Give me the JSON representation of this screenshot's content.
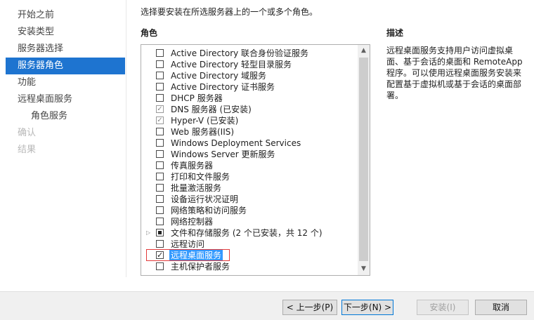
{
  "nav": {
    "items": [
      {
        "label": "开始之前",
        "state": "normal"
      },
      {
        "label": "安装类型",
        "state": "normal"
      },
      {
        "label": "服务器选择",
        "state": "normal"
      },
      {
        "label": "服务器角色",
        "state": "active"
      },
      {
        "label": "功能",
        "state": "normal"
      },
      {
        "label": "远程桌面服务",
        "state": "normal"
      },
      {
        "label": "角色服务",
        "state": "sub"
      },
      {
        "label": "确认",
        "state": "disabled"
      },
      {
        "label": "结果",
        "state": "disabled"
      }
    ]
  },
  "instruction": "选择要安装在所选服务器上的一个或多个角色。",
  "roles_header": "角色",
  "desc_header": "描述",
  "roles": [
    {
      "label": "Active Directory 联合身份验证服务",
      "check": "unchecked"
    },
    {
      "label": "Active Directory 轻型目录服务",
      "check": "unchecked"
    },
    {
      "label": "Active Directory 域服务",
      "check": "unchecked"
    },
    {
      "label": "Active Directory 证书服务",
      "check": "unchecked"
    },
    {
      "label": "DHCP 服务器",
      "check": "unchecked"
    },
    {
      "label": "DNS 服务器 (已安装)",
      "check": "disabled-checked"
    },
    {
      "label": "Hyper-V (已安装)",
      "check": "disabled-checked"
    },
    {
      "label": "Web 服务器(IIS)",
      "check": "unchecked"
    },
    {
      "label": "Windows Deployment Services",
      "check": "unchecked"
    },
    {
      "label": "Windows Server 更新服务",
      "check": "unchecked"
    },
    {
      "label": "传真服务器",
      "check": "unchecked"
    },
    {
      "label": "打印和文件服务",
      "check": "unchecked"
    },
    {
      "label": "批量激活服务",
      "check": "unchecked"
    },
    {
      "label": "设备运行状况证明",
      "check": "unchecked"
    },
    {
      "label": "网络策略和访问服务",
      "check": "unchecked"
    },
    {
      "label": "网络控制器",
      "check": "unchecked"
    },
    {
      "label": "文件和存储服务 (2 个已安装，共 12 个)",
      "check": "partial",
      "expandable": true
    },
    {
      "label": "远程访问",
      "check": "unchecked"
    },
    {
      "label": "远程桌面服务",
      "check": "checked",
      "selected": true,
      "highlighted": true
    },
    {
      "label": "主机保护者服务",
      "check": "unchecked"
    }
  ],
  "description": "远程桌面服务支持用户访问虚拟桌面、基于会话的桌面和 RemoteApp 程序。可以使用远程桌面服务安装来配置基于虚拟机或基于会话的桌面部署。",
  "buttons": {
    "prev": "< 上一步(P)",
    "next": "下一步(N) >",
    "install": "安装(I)",
    "cancel": "取消"
  },
  "icons": {
    "expander": "expand-triangle-icon",
    "scroll_up": "chevron-up-icon",
    "scroll_down": "chevron-down-icon"
  }
}
